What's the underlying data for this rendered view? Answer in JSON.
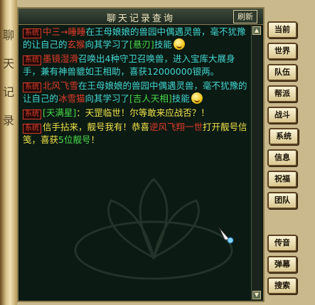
{
  "window": {
    "title": "聊天记录查询",
    "refresh_label": "刷新"
  },
  "side_scroll_glyphs": [
    "聊",
    "天",
    "记",
    "录"
  ],
  "messages": [
    {
      "tag": "系统",
      "parts": [
        {
          "text": "中三→睡睡",
          "color": "red"
        },
        {
          "text": "在王母娘娘的兽园中偶遇灵兽，毫不犹豫的让自己的",
          "color": "cyan"
        },
        {
          "text": "玄猴",
          "color": "red"
        },
        {
          "text": "向其学习了",
          "color": "cyan"
        },
        {
          "text": "[悬刃]",
          "color": "green"
        },
        {
          "text": "技能",
          "color": "cyan"
        }
      ],
      "emoji": "laugh-emoji"
    },
    {
      "tag": "系统",
      "parts": [
        {
          "text": "墨镜湿滑",
          "color": "red"
        },
        {
          "text": "召唤出4种守卫召唤兽，进入宝库大展身手，兼有神兽貔如王相助，喜获",
          "color": "cyan"
        },
        {
          "text": "12000000",
          "color": "cyan"
        },
        {
          "text": "银两",
          "color": "cyan"
        },
        {
          "text": "。",
          "color": "cyan"
        }
      ]
    },
    {
      "tag": "系统",
      "parts": [
        {
          "text": "北风飞雪",
          "color": "red"
        },
        {
          "text": "在王母娘娘的兽园中偶遇灵兽，毫不犹豫的让自己的",
          "color": "cyan"
        },
        {
          "text": "冰雪猫",
          "color": "red"
        },
        {
          "text": "向其学习了",
          "color": "cyan"
        },
        {
          "text": "[吉人天相]",
          "color": "green"
        },
        {
          "text": "技能",
          "color": "cyan"
        }
      ],
      "emoji": "laugh-emoji"
    },
    {
      "tag": "系统",
      "parts": [
        {
          "text": "[天满星]",
          "color": "green"
        },
        {
          "text": "：天罡临世！尔等敢来应战否？！",
          "color": "yellow"
        }
      ]
    },
    {
      "tag": "系统",
      "parts": [
        {
          "text": "信手拈来，靓号我有！恭喜",
          "color": "yellow"
        },
        {
          "text": "逆风飞翔一世",
          "color": "red"
        },
        {
          "text": "打开靓号信笺，喜获",
          "color": "yellow"
        },
        {
          "text": "5位靓号",
          "color": "green"
        },
        {
          "text": "！",
          "color": "yellow"
        }
      ]
    }
  ],
  "channels": [
    "当前",
    "世界",
    "队伍",
    "帮派",
    "战斗",
    "系统",
    "信息",
    "祝福",
    "团队",
    "传音",
    "弹幕",
    "搜索"
  ],
  "colors": {
    "red": "#e23a2a",
    "cyan": "#42d6d0",
    "green": "#4ad94a",
    "yellow": "#f1e24a",
    "window_bg": "#0b1a13"
  }
}
